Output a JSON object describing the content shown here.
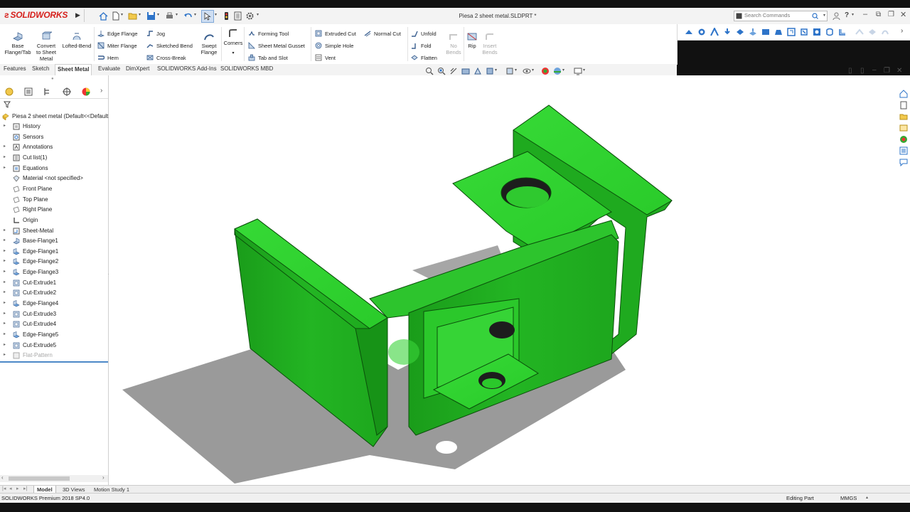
{
  "app": {
    "logo_text": "SOLIDWORKS",
    "document_title": "Piesa 2 sheet metal.SLDPRT *",
    "search_placeholder": "Search Commands"
  },
  "ribbon": {
    "big_buttons": [
      {
        "label": "Base Flange/Tab",
        "icon": "base-flange-icon",
        "enabled": true
      },
      {
        "label": "Convert to Sheet Metal",
        "icon": "convert-sheet-metal-icon",
        "enabled": true
      },
      {
        "label": "Lofted-Bend",
        "icon": "lofted-bend-icon",
        "enabled": true
      }
    ],
    "col1": [
      {
        "label": "Edge Flange",
        "icon": "edge-flange-icon"
      },
      {
        "label": "Miter Flange",
        "icon": "miter-flange-icon"
      },
      {
        "label": "Hem",
        "icon": "hem-icon"
      }
    ],
    "col2": [
      {
        "label": "Jog",
        "icon": "jog-icon"
      },
      {
        "label": "Sketched Bend",
        "icon": "sketched-bend-icon"
      },
      {
        "label": "Cross-Break",
        "icon": "cross-break-icon"
      }
    ],
    "swept_flange": "Swept Flange",
    "corners": "Corners",
    "col3": [
      {
        "label": "Forming Tool",
        "icon": "forming-tool-icon"
      },
      {
        "label": "Sheet Metal Gusset",
        "icon": "gusset-icon"
      },
      {
        "label": "Tab and Slot",
        "icon": "tab-slot-icon"
      }
    ],
    "col4": [
      {
        "label": "Extruded Cut",
        "icon": "extruded-cut-icon"
      },
      {
        "label": "Simple Hole",
        "icon": "simple-hole-icon"
      },
      {
        "label": "Vent",
        "icon": "vent-icon"
      }
    ],
    "normal_cut": "Normal Cut",
    "col5": [
      {
        "label": "Unfold",
        "icon": "unfold-icon"
      },
      {
        "label": "Fold",
        "icon": "fold-icon"
      },
      {
        "label": "Flatten",
        "icon": "flatten-icon"
      }
    ],
    "no_bends": "No Bends",
    "rip": "Rip",
    "insert_bends": "Insert Bends"
  },
  "tabs": [
    "Features",
    "Sketch",
    "Sheet Metal",
    "Evaluate",
    "DimXpert",
    "SOLIDWORKS Add-Ins",
    "SOLIDWORKS MBD"
  ],
  "active_tab": "Sheet Metal",
  "feature_tree": {
    "root": "Piesa 2 sheet metal  (Default<<Default",
    "items": [
      {
        "label": "History",
        "expand": true,
        "icon": "history-folder-icon",
        "suppressed": false
      },
      {
        "label": "Sensors",
        "expand": false,
        "icon": "sensors-icon",
        "suppressed": false
      },
      {
        "label": "Annotations",
        "expand": true,
        "icon": "annotations-icon",
        "suppressed": false
      },
      {
        "label": "Cut list(1)",
        "expand": true,
        "icon": "cut-list-icon",
        "suppressed": false
      },
      {
        "label": "Equations",
        "expand": true,
        "icon": "equations-icon",
        "suppressed": false
      },
      {
        "label": "Material <not specified>",
        "expand": false,
        "icon": "material-icon",
        "suppressed": false
      },
      {
        "label": "Front Plane",
        "expand": false,
        "icon": "plane-icon",
        "suppressed": false
      },
      {
        "label": "Top Plane",
        "expand": false,
        "icon": "plane-icon",
        "suppressed": false
      },
      {
        "label": "Right Plane",
        "expand": false,
        "icon": "plane-icon",
        "suppressed": false
      },
      {
        "label": "Origin",
        "expand": false,
        "icon": "origin-icon",
        "suppressed": false
      },
      {
        "label": "Sheet-Metal",
        "expand": true,
        "icon": "sheet-metal-icon",
        "suppressed": false
      },
      {
        "label": "Base-Flange1",
        "expand": true,
        "icon": "base-flange-icon",
        "suppressed": false
      },
      {
        "label": "Edge-Flange1",
        "expand": true,
        "icon": "edge-flange-icon",
        "suppressed": false
      },
      {
        "label": "Edge-Flange2",
        "expand": true,
        "icon": "edge-flange-icon",
        "suppressed": false
      },
      {
        "label": "Edge-Flange3",
        "expand": true,
        "icon": "edge-flange-icon",
        "suppressed": false
      },
      {
        "label": "Cut-Extrude1",
        "expand": true,
        "icon": "cut-extrude-icon",
        "suppressed": false
      },
      {
        "label": "Cut-Extrude2",
        "expand": true,
        "icon": "cut-extrude-icon",
        "suppressed": false
      },
      {
        "label": "Edge-Flange4",
        "expand": true,
        "icon": "edge-flange-icon",
        "suppressed": false
      },
      {
        "label": "Cut-Extrude3",
        "expand": true,
        "icon": "cut-extrude-icon",
        "suppressed": false
      },
      {
        "label": "Cut-Extrude4",
        "expand": true,
        "icon": "cut-extrude-icon",
        "suppressed": false
      },
      {
        "label": "Edge-Flange5",
        "expand": true,
        "icon": "edge-flange-icon",
        "suppressed": false
      },
      {
        "label": "Cut-Extrude5",
        "expand": true,
        "icon": "cut-extrude-icon",
        "suppressed": false
      },
      {
        "label": "Flat-Pattern",
        "expand": true,
        "icon": "flat-pattern-icon",
        "suppressed": true
      }
    ]
  },
  "bottom_tabs": [
    "Model",
    "3D Views",
    "Motion Study 1"
  ],
  "active_bottom_tab": "Model",
  "status": {
    "left": "SOLIDWORKS Premium 2018 SP4.0",
    "mode": "Editing Part",
    "units": "MMGS"
  },
  "colors": {
    "part_green": "#22c322",
    "part_green_light": "#3ee23e",
    "part_green_dark": "#138f13",
    "logo_red": "#d6201c",
    "accent_blue": "#2e74c9"
  }
}
